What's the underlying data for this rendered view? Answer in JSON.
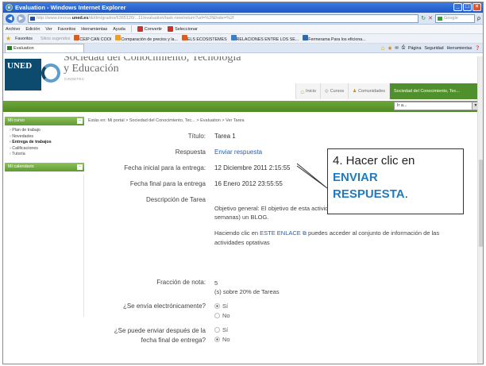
{
  "window": {
    "title": "Evaluation - Windows Internet Explorer",
    "minimize": "_",
    "maximize": "□",
    "close": "×"
  },
  "addressbar": {
    "back": "◀",
    "forward": "▶",
    "url_prefix": "http://www.innova.",
    "url_domain": "uned.es",
    "url_rest": "/dotlrn/grados/6365120/...11/evaluation/task-new/return?url=%2f&hide=%2f",
    "refresh": "↻",
    "stop": "✕",
    "search_placeholder": "Google",
    "search_go": "ρ"
  },
  "menubar": {
    "items": [
      "Archivo",
      "Edición",
      "Ver",
      "Favoritos",
      "Herramientas",
      "Ayuda"
    ],
    "convert": "Convertir",
    "select": "Seleccionar"
  },
  "favbar": {
    "favorites": "Favoritos",
    "suggested": "Sitios sugeridos",
    "items": [
      "CEIP CAN COOI",
      "Comparación de precios y la...",
      "ELS ECOSISTEMES",
      "RELACIONES ENTRE LOS SE...",
      "Fermerama Para los eficiona..."
    ]
  },
  "tabbar": {
    "tab_label": "Evaluation",
    "tools": [
      "Página",
      "Seguridad",
      "Herramientas"
    ]
  },
  "banner": {
    "logo": "UNED",
    "title_line1": "Sociedad del Conocimiento, Tecnología",
    "title_line2": "y Educación",
    "subtitle": "CINDETEC"
  },
  "topnav": {
    "home": "Inicio",
    "courses": "Cursos",
    "communities": "Comunidades",
    "active": "Sociedad del Conocimiento, Tec..."
  },
  "greenbar": {
    "goto": "Ir a..."
  },
  "sidebar": {
    "my_course": "Mi curso",
    "items": [
      "Plan de trabajo",
      "Novedades",
      "Entrega de trabajos",
      "Calificaciones",
      "Tutoría"
    ],
    "calendar": "Mi calendario",
    "collapse": "−"
  },
  "breadcrumb": "Estás en: Mi portal > Sociedad del Conocimiento, Tec... > Evaluation > Ver Tarea",
  "task": {
    "title_label": "Título:",
    "title_value": "Tarea 1",
    "answer_label": "Respuesta",
    "answer_link": "Enviar respuesta",
    "start_label": "Fecha inicial para la entrega:",
    "start_value": "12 Diciembre 2011 2:15:55",
    "end_label": "Fecha final para la entrega",
    "end_value": "16 Enero 2012 23:55:55",
    "desc_label": "Descripción de Tarea",
    "desc_p1": "Objetivo general: El objetivo de esta actividad es crear, utilizar y mantener (durante 2-3 semanas) un BLOG.",
    "desc_p2_pre": "Haciendo clic en",
    "desc_p2_link": "ESTE ENLACE",
    "desc_p2_post": "puedes acceder al conjunto de información de las actividades optativas",
    "grade_label": "Fracción de nota:",
    "grade_value": "5",
    "grade_note": "(s) sobre 20% de Tareas",
    "electronic_label": "¿Se envía electrónicamente?",
    "yes": "Sí",
    "no": "No",
    "late_label": "¿Se puede enviar después de la",
    "late_label2": "fecha final de entrega?",
    "late_yes": "Sí",
    "late_no": "No"
  },
  "callout": {
    "text_pre": "4. Hacer clic en",
    "highlight1": "ENVIAR",
    "highlight2": "RESPUESTA",
    "text_post": "."
  }
}
